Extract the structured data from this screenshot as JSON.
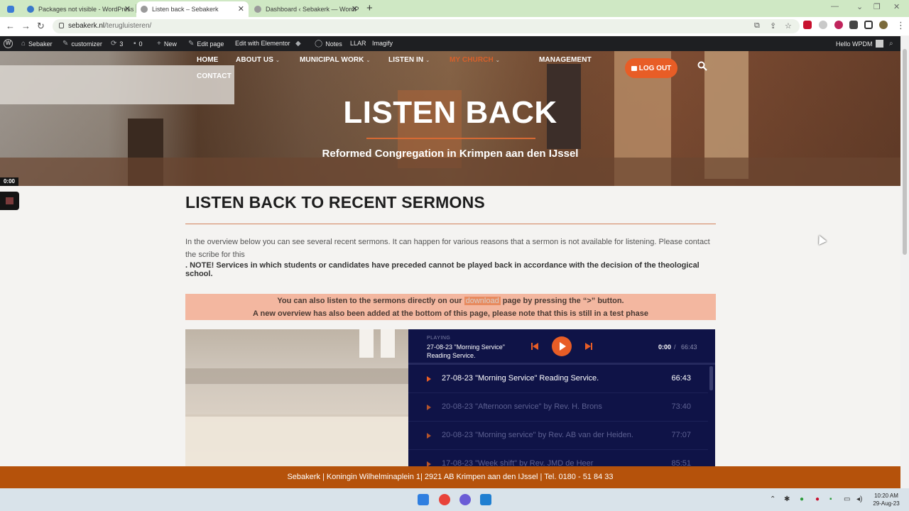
{
  "browser": {
    "tabs": [
      {
        "title": "Packages not visible - WordPress"
      },
      {
        "title": "Listen back – Sebakerk"
      },
      {
        "title": "Dashboard ‹ Sebakerk — WordP"
      }
    ],
    "url_host": "sebakerk.nl",
    "url_path": "/terugluisteren/"
  },
  "admin_bar": {
    "site": "Sebaker",
    "customizer": "customizer",
    "updates_count": "3",
    "comments_count": "0",
    "new": "New",
    "edit_page": "Edit page",
    "elementor": "Edit with Elementor",
    "notes": "Notes",
    "llar": "LLAR",
    "imagify": "Imagify",
    "greeting": "Hello WPDM"
  },
  "nav": {
    "home": "HOME",
    "about": "ABOUT US",
    "municipal": "MUNICIPAL WORK",
    "listen": "LISTEN IN",
    "church": "MY CHURCH",
    "management": "MANAGEMENT",
    "contact": "CONTACT",
    "logout": "LOG OUT"
  },
  "hero": {
    "title": "LISTEN BACK",
    "subtitle": "Reformed Congregation in Krimpen aan den IJssel",
    "timer": "0:00"
  },
  "content": {
    "heading": "LISTEN BACK TO RECENT SERMONS",
    "intro": "In the overview below you can see several recent sermons. It can happen for various reasons that a sermon is not available for listening. Please contact the scribe for this",
    "note": ". NOTE! Services in which students or candidates have preceded cannot be played back in accordance with the decision of the theological school.",
    "notice_a": "You can also listen to the sermons directly on our ",
    "notice_link": "download",
    "notice_b": " page by pressing the “>” button.",
    "notice_line2": "A new overview has also been added at the bottom of this page, please note that this is still in a test phase"
  },
  "player": {
    "label": "PLAYING",
    "now_playing": "27-08-23 \"Morning Service\" Reading Service.",
    "current_time": "0:00",
    "separator": "/",
    "duration": "66:43",
    "tracks": [
      {
        "title": "27-08-23 \"Morning Service\" Reading Service.",
        "duration": "66:43"
      },
      {
        "title": "20-08-23 \"Afternoon service\" by Rev. H. Brons",
        "duration": "73:40"
      },
      {
        "title": "20-08-23 \"Morning service\" by Rev. AB van der Heiden.",
        "duration": "77:07"
      },
      {
        "title": "17-08-23 \"Week shift\" by Rev. JMD de Heer",
        "duration": "85:51"
      }
    ]
  },
  "footer": {
    "text": "Sebakerk | Koningin Wilhelminaplein 1| 2921 AB Krimpen aan den IJssel | Tel. 0180 - 51 84 33"
  },
  "taskbar": {
    "time": "10:20 AM",
    "date": "29-Aug-23"
  },
  "colors": {
    "accent": "#e85d26",
    "footer": "#b5520b",
    "player_bg": "#0f1347",
    "notice_bg": "#f3b7a0"
  }
}
